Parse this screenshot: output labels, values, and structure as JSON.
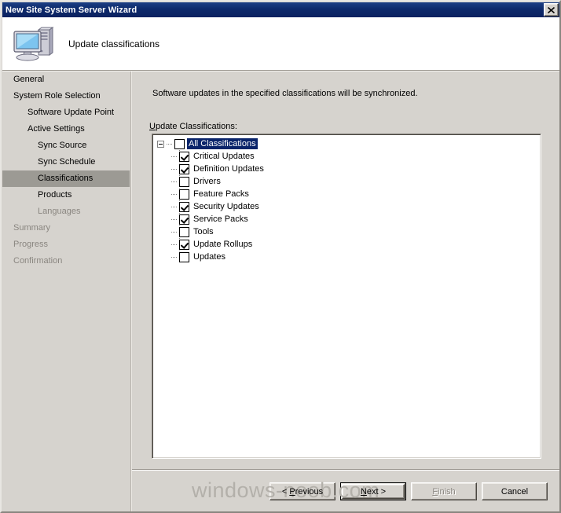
{
  "window": {
    "title": "New Site System Server Wizard",
    "close_label": "Close"
  },
  "header": {
    "icon": "server-computer-icon",
    "title": "Update classifications"
  },
  "sidebar": {
    "items": [
      {
        "label": "General",
        "indent": 0,
        "state": "normal"
      },
      {
        "label": "System Role Selection",
        "indent": 0,
        "state": "normal"
      },
      {
        "label": "Software Update Point",
        "indent": 1,
        "state": "normal"
      },
      {
        "label": "Active Settings",
        "indent": 1,
        "state": "normal"
      },
      {
        "label": "Sync Source",
        "indent": 2,
        "state": "normal"
      },
      {
        "label": "Sync Schedule",
        "indent": 2,
        "state": "normal"
      },
      {
        "label": "Classifications",
        "indent": 2,
        "state": "selected"
      },
      {
        "label": "Products",
        "indent": 2,
        "state": "normal"
      },
      {
        "label": "Languages",
        "indent": 2,
        "state": "disabled"
      },
      {
        "label": "Summary",
        "indent": 0,
        "state": "disabled"
      },
      {
        "label": "Progress",
        "indent": 0,
        "state": "disabled"
      },
      {
        "label": "Confirmation",
        "indent": 0,
        "state": "disabled"
      }
    ]
  },
  "content": {
    "description": "Software updates in the specified classifications will be synchronized.",
    "group_label_accel": "U",
    "group_label_rest": "pdate Classifications:",
    "tree": {
      "root": {
        "label": "All Classifications",
        "checked": false,
        "selected": true,
        "expanded": true,
        "expander_glyph": "minus"
      },
      "children": [
        {
          "label": "Critical Updates",
          "checked": true
        },
        {
          "label": "Definition Updates",
          "checked": true
        },
        {
          "label": "Drivers",
          "checked": false
        },
        {
          "label": "Feature Packs",
          "checked": false
        },
        {
          "label": "Security Updates",
          "checked": true
        },
        {
          "label": "Service Packs",
          "checked": true
        },
        {
          "label": "Tools",
          "checked": false
        },
        {
          "label": "Update Rollups",
          "checked": true
        },
        {
          "label": "Updates",
          "checked": false
        }
      ]
    }
  },
  "footer": {
    "buttons": [
      {
        "name": "previous",
        "pre": "< ",
        "accel": "P",
        "post": "revious",
        "state": "enabled"
      },
      {
        "name": "next",
        "pre": "",
        "accel": "N",
        "post": "ext >",
        "state": "default"
      },
      {
        "name": "finish",
        "pre": "",
        "accel": "F",
        "post": "inish",
        "state": "disabled"
      },
      {
        "name": "cancel",
        "pre": "",
        "accel": "",
        "post": "Cancel",
        "state": "enabled"
      }
    ]
  },
  "watermark": {
    "text": "windows-noob.com"
  },
  "colors": {
    "titlebar": "#0e2a6b",
    "face": "#d6d3ce",
    "selection": "#0a246a",
    "sidebar_selected": "#9c9a94",
    "disabled_text": "#8a8680"
  }
}
